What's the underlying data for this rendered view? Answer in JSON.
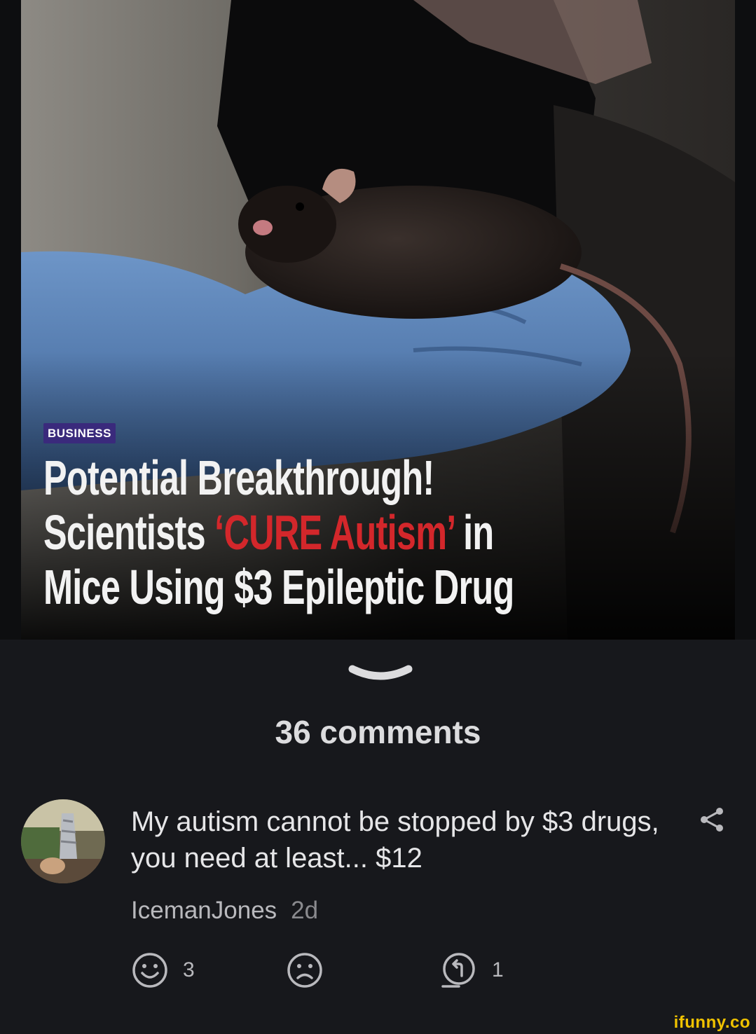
{
  "article": {
    "category": "BUSINESS",
    "headline_line1": "Potential Breakthrough!",
    "headline_line2_a": "Scientists ",
    "headline_line2_red": "‘CURE Autism’",
    "headline_line2_b": " in",
    "headline_line3": "Mice Using $3 Epileptic Drug"
  },
  "comments": {
    "count_label": "36 comments"
  },
  "comment": {
    "text": "My autism cannot be stopped by $3 drugs, you need at least... $12",
    "author": "IcemanJones",
    "time": "2d",
    "smile_count": "3",
    "frown_count": "",
    "reply_count": "1"
  },
  "watermark": "ifunny.co",
  "icons": {
    "chevron": "chevron-down-icon",
    "share": "share-icon",
    "smile": "smile-icon",
    "frown": "frown-icon",
    "reply": "reply-icon"
  },
  "colors": {
    "background": "#17181c",
    "headline_red": "#d3272b",
    "badge": "#3a2a7c",
    "watermark": "#f0c200"
  }
}
